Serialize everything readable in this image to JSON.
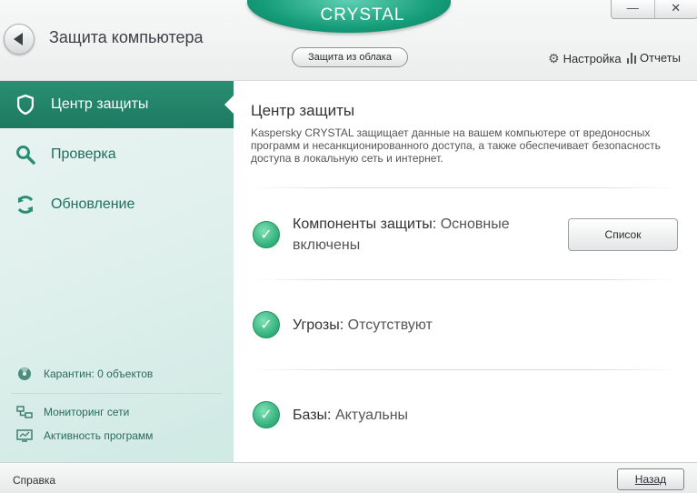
{
  "header": {
    "title": "Защита компьютера",
    "brand": "CRYSTAL",
    "cloud_button": "Защита из облака",
    "settings": "Настройка",
    "reports": "Отчеты",
    "minimize_glyph": "—",
    "close_glyph": "✕"
  },
  "sidebar": {
    "items": [
      {
        "label": "Центр защиты",
        "icon": "shield-icon",
        "active": true
      },
      {
        "label": "Проверка",
        "icon": "search-icon",
        "active": false
      },
      {
        "label": "Обновление",
        "icon": "refresh-icon",
        "active": false
      }
    ],
    "quarantine": "Карантин: 0 объектов",
    "network_monitoring": "Мониторинг сети",
    "program_activity": "Активность программ"
  },
  "main": {
    "title": "Центр защиты",
    "description": "Kaspersky CRYSTAL защищает данные на вашем компьютере от вредоносных программ и несанкционированного доступа, а также обеспечивает безопасность доступа в локальную сеть и интернет.",
    "statuses": [
      {
        "label": "Компоненты защиты:",
        "value": "Основные включены"
      },
      {
        "label": "Угрозы:",
        "value": "Отсутствуют"
      },
      {
        "label": "Базы:",
        "value": "Актуальны"
      }
    ],
    "list_button": "Список"
  },
  "footer": {
    "help": "Справка",
    "back": "Назад"
  },
  "colors": {
    "accent": "#1c7a61",
    "status_ok": "#2eae78"
  }
}
